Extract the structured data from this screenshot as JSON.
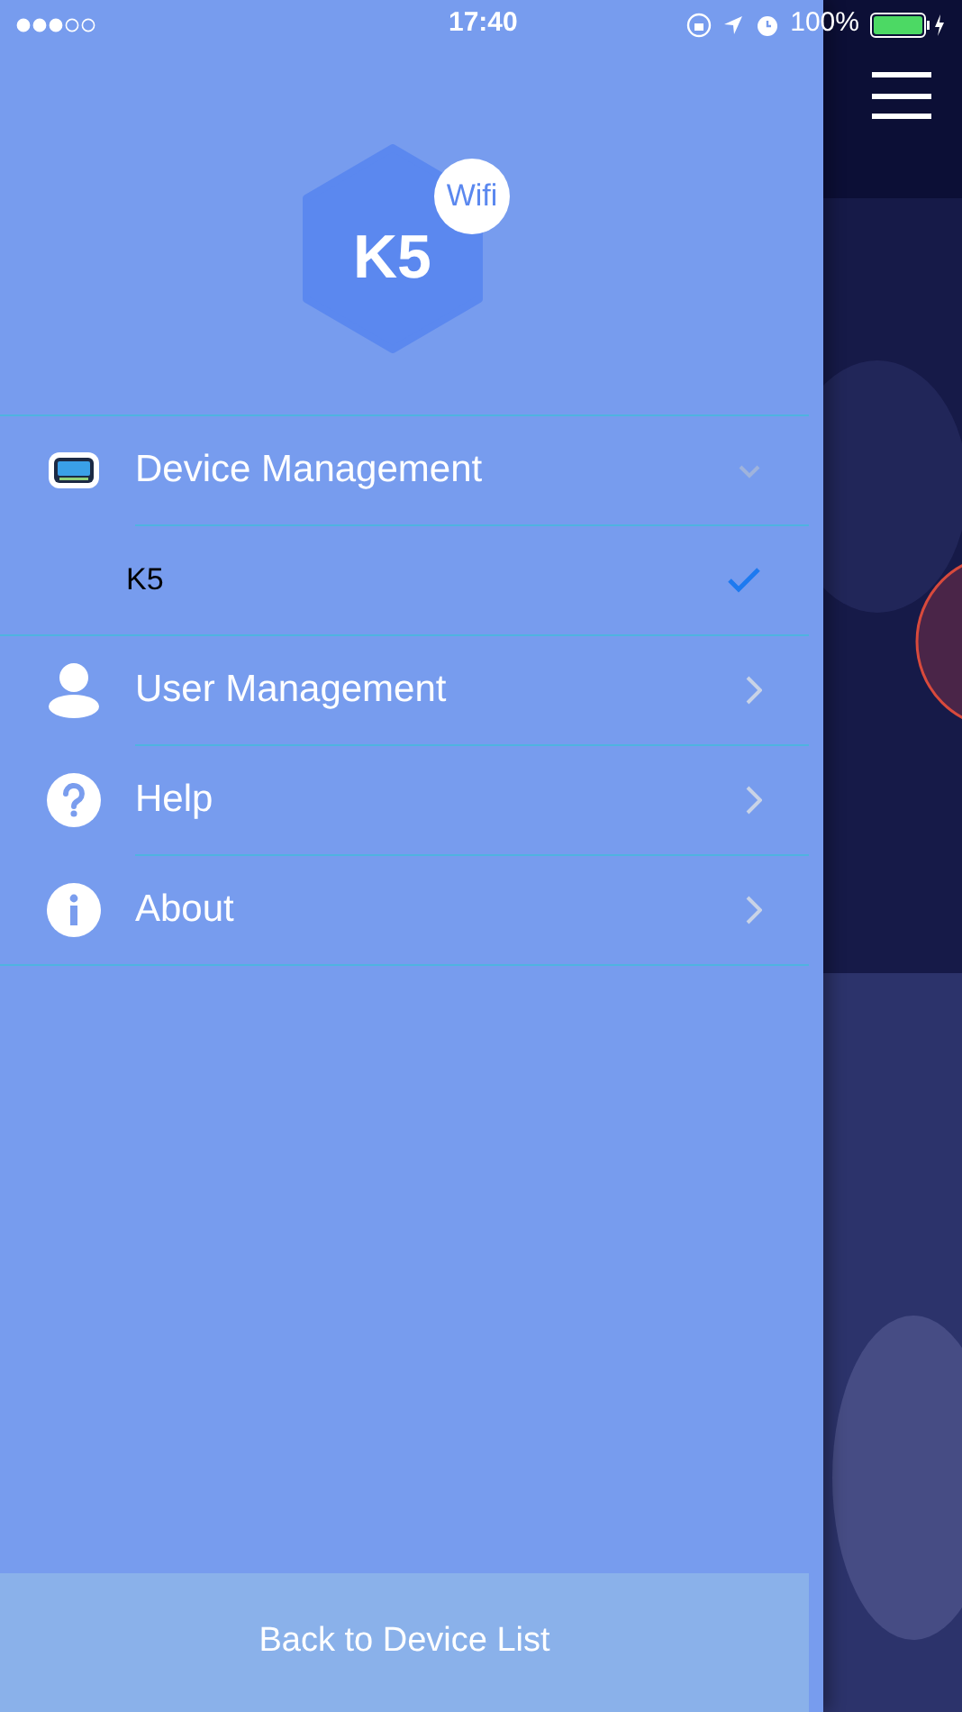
{
  "status_bar": {
    "time": "17:40",
    "battery": "100%"
  },
  "logo": {
    "title": "K5",
    "badge": "Wifi"
  },
  "menu": [
    {
      "kind": "group",
      "label": "Device Management",
      "expanded": true
    },
    {
      "kind": "subitem",
      "label": "K5",
      "selected": true
    },
    {
      "kind": "link",
      "label": "User Management"
    },
    {
      "kind": "link",
      "label": "Help"
    },
    {
      "kind": "link",
      "label": "About"
    }
  ],
  "footer_button": "Back to Device List"
}
